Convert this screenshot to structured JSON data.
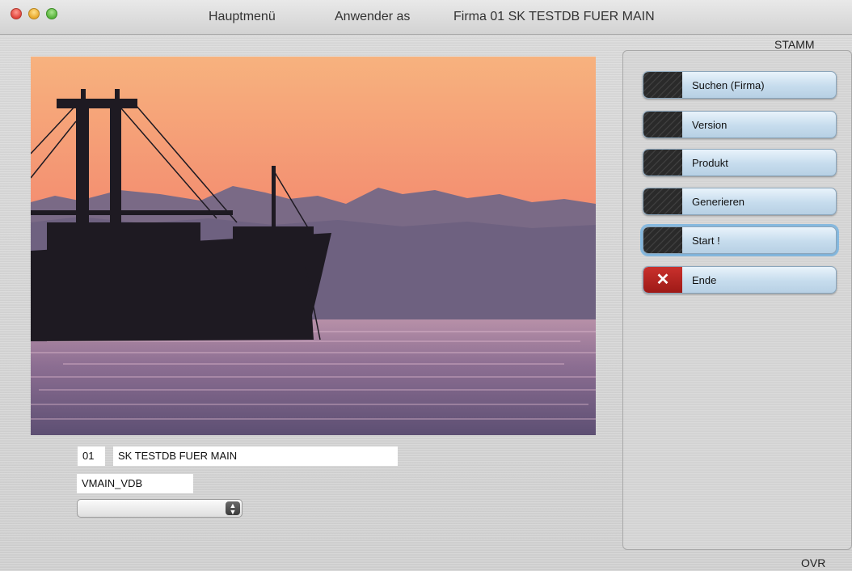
{
  "window": {
    "menu_title": "Hauptmenü",
    "user_label": "Anwender as",
    "firm_label": "Firma 01 SK TESTDB FUER MAIN"
  },
  "header": {
    "section_label": "STAMM"
  },
  "form": {
    "firm_number": "01",
    "firm_name": "SK TESTDB FUER MAIN",
    "database": "VMAIN_VDB",
    "select_value": ""
  },
  "actions": [
    {
      "label": "Suchen (Firma)"
    },
    {
      "label": "Version"
    },
    {
      "label": "Produkt"
    },
    {
      "label": "Generieren"
    },
    {
      "label": "Start !"
    },
    {
      "label": "Ende"
    }
  ],
  "status": {
    "mode": "OVR"
  },
  "icons": {
    "close_button": "x-icon",
    "select_arrows": "updown-arrows-icon"
  },
  "colors": {
    "button_face": "#c6dced",
    "end_button": "#b8241f"
  }
}
